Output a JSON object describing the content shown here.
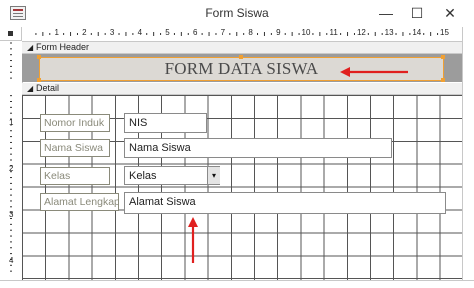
{
  "window": {
    "title": "Form Siswa",
    "minimize_glyph": "—",
    "maximize_glyph": "☐",
    "close_glyph": "✕"
  },
  "ruler": {
    "marks": [
      "1",
      "2",
      "3",
      "4",
      "5",
      "6",
      "7",
      "8",
      "9",
      "10",
      "11",
      "12",
      "13",
      "14",
      "15"
    ],
    "vmarks": [
      "1",
      "2",
      "3",
      "4"
    ]
  },
  "sections": {
    "header_label": "Form Header",
    "detail_label": "Detail",
    "collapse_glyph": "◢"
  },
  "form": {
    "title": "FORM DATA SISWA",
    "fields": [
      {
        "label": "Nomor Induk",
        "value": "NIS"
      },
      {
        "label": "Nama Siswa",
        "value": "Nama Siswa"
      },
      {
        "label": "Kelas",
        "value": "Kelas"
      },
      {
        "label": "Alamat Lengkap",
        "value": "Alamat Siswa"
      }
    ],
    "dropdown_glyph": "▾"
  },
  "colors": {
    "accent_selection": "#f0a033",
    "arrow": "#e0201f",
    "grid": "#555555"
  }
}
